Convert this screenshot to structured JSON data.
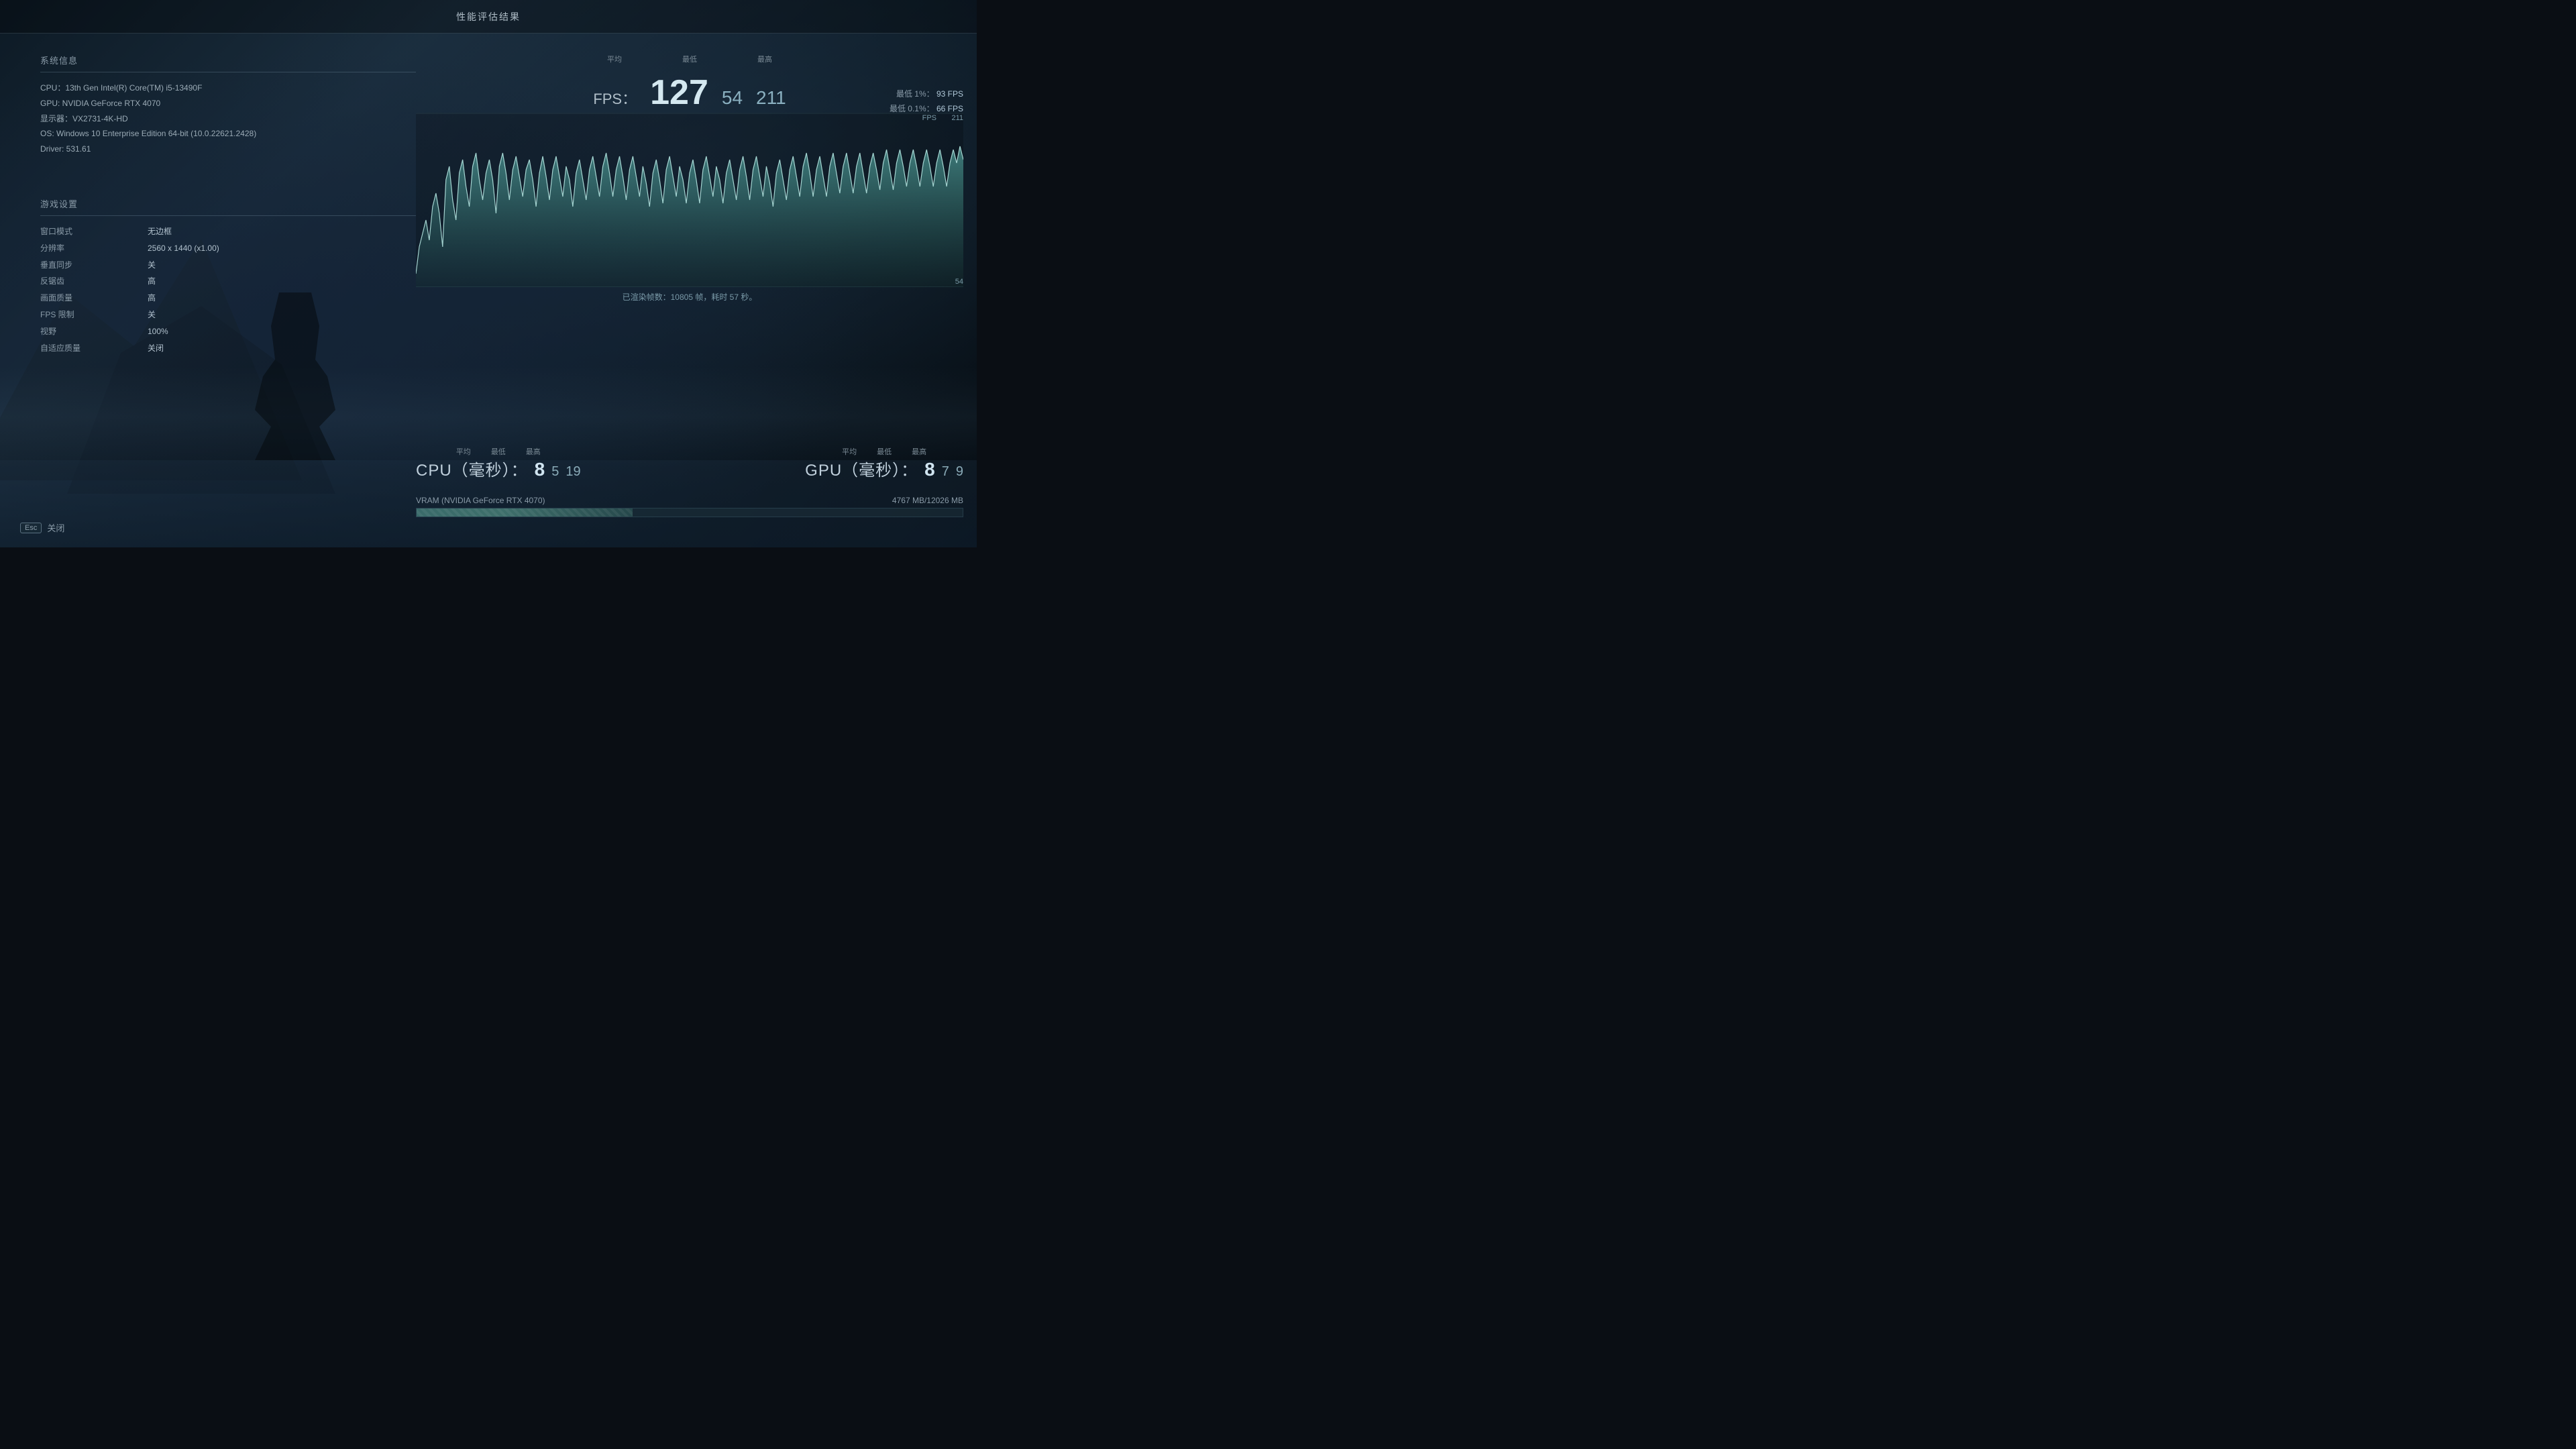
{
  "title": "性能评估结果",
  "system_info": {
    "section_title": "系统信息",
    "cpu": "CPU：13th Gen Intel(R) Core(TM) i5-13490F",
    "gpu": "GPU: NVIDIA GeForce RTX 4070",
    "display": "显示器：VX2731-4K-HD",
    "os": "OS: Windows 10 Enterprise Edition 64-bit (10.0.22621.2428)",
    "driver": "Driver: 531.61"
  },
  "game_settings": {
    "section_title": "游戏设置",
    "settings": [
      {
        "label": "窗口模式",
        "value": "无边框"
      },
      {
        "label": "分辨率",
        "value": "2560 x 1440 (x1.00)"
      },
      {
        "label": "垂直同步",
        "value": "关"
      },
      {
        "label": "反锯齿",
        "value": "高"
      },
      {
        "label": "画面质量",
        "value": "高"
      },
      {
        "label": "FPS 限制",
        "value": "关"
      },
      {
        "label": "视野",
        "value": "100%"
      },
      {
        "label": "自适应质量",
        "value": "关闭"
      }
    ]
  },
  "fps_stats": {
    "labels": {
      "avg": "平均",
      "min": "最低",
      "max": "最高"
    },
    "fps_label": "FPS：",
    "avg": "127",
    "min": "54",
    "max": "211",
    "percentile_1_label": "最低 1%：",
    "percentile_1_value": "93 FPS",
    "percentile_01_label": "最低 0.1%：",
    "percentile_01_value": "66 FPS",
    "chart_fps_label": "FPS",
    "chart_max_label": "211",
    "chart_min_label": "54",
    "render_info": "已渲染帧数：10805 帧，耗时 57 秒。"
  },
  "cpu_metrics": {
    "label": "CPU（毫秒）：",
    "avg_label": "平均",
    "min_label": "最低",
    "max_label": "最高",
    "avg": "8",
    "min": "5",
    "max": "19"
  },
  "gpu_metrics": {
    "label": "GPU（毫秒）：",
    "avg_label": "平均",
    "min_label": "最低",
    "max_label": "最高",
    "avg": "8",
    "min": "7",
    "max": "9"
  },
  "vram": {
    "label": "VRAM (NVIDIA GeForce RTX 4070)",
    "value": "4767 MB/12026 MB",
    "fill_percent": 39.6
  },
  "close_button": {
    "esc_key": "Esc",
    "label": "关闭"
  }
}
